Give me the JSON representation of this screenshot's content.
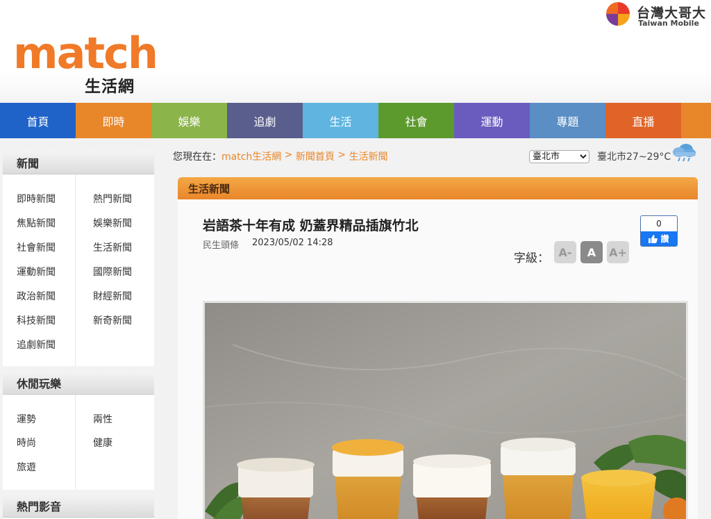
{
  "brand": {
    "logo_main": "match",
    "logo_sub": "生活網",
    "partner_zh": "台灣大哥大",
    "partner_en": "Taiwan Mobile"
  },
  "nav": {
    "items": [
      {
        "label": "首頁",
        "color": "#1f63c8"
      },
      {
        "label": "即時",
        "color": "#e8862a"
      },
      {
        "label": "娛樂",
        "color": "#8bb44a"
      },
      {
        "label": "追劇",
        "color": "#595e8c"
      },
      {
        "label": "生活",
        "color": "#60b5e0"
      },
      {
        "label": "社會",
        "color": "#5c9a2e"
      },
      {
        "label": "運動",
        "color": "#6a5cbf"
      },
      {
        "label": "專題",
        "color": "#5a8ec5"
      },
      {
        "label": "直播",
        "color": "#e06428"
      }
    ]
  },
  "sidebar": {
    "news": {
      "title": "新聞",
      "links": [
        "即時新聞",
        "熱門新聞",
        "焦點新聞",
        "娛樂新聞",
        "社會新聞",
        "生活新聞",
        "運動新聞",
        "國際新聞",
        "政治新聞",
        "財經新聞",
        "科技新聞",
        "新奇新聞",
        "追劇新聞"
      ]
    },
    "leisure": {
      "title": "休閒玩樂",
      "links": [
        "運勢",
        "兩性",
        "時尚",
        "健康",
        "旅遊"
      ]
    },
    "video": {
      "title": "熱門影音"
    }
  },
  "breadcrumb": {
    "prefix": "您現在在：",
    "items": [
      "match生活網",
      "新聞首頁",
      "生活新聞"
    ],
    "separator": " > "
  },
  "weather": {
    "selected_city": "臺北市",
    "text": "臺北市27~29°C"
  },
  "article": {
    "section": "生活新聞",
    "title": "岩語茶十年有成 奶蓋界精品插旗竹北",
    "category": "民生頭條",
    "datetime": "2023/05/02 14:28",
    "font_label": "字級：",
    "font_small": "A-",
    "font_normal": "A",
    "font_large": "A+",
    "like_count": "0",
    "like_label": "讚"
  },
  "colors": {
    "accent": "#e8862a",
    "brand": "#f07a28"
  }
}
